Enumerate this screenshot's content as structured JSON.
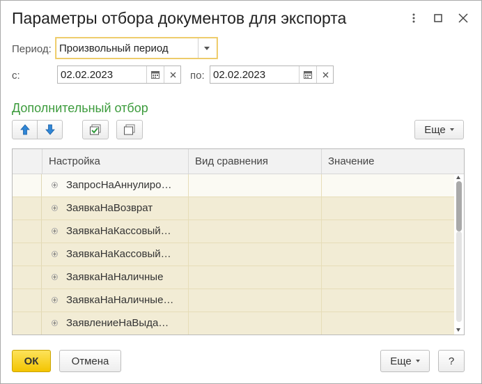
{
  "window": {
    "title": "Параметры отбора документов для экспорта"
  },
  "period": {
    "label": "Период:",
    "value": "Произвольный период"
  },
  "range": {
    "from_label": "с:",
    "from_value": "02.02.2023",
    "to_label": "по:",
    "to_value": "02.02.2023"
  },
  "filter": {
    "section_title": "Дополнительный отбор",
    "more_label": "Еще",
    "columns": [
      "Настройка",
      "Вид сравнения",
      "Значение"
    ],
    "rows": [
      "ЗапросНаАннулиро…",
      "ЗаявкаНаВозврат",
      "ЗаявкаНаКассовый…",
      "ЗаявкаНаКассовый…",
      "ЗаявкаНаНаличные",
      "ЗаявкаНаНаличные…",
      "ЗаявлениеНаВыда…"
    ]
  },
  "footer": {
    "ok_label": "ОК",
    "cancel_label": "Отмена",
    "more_label": "Еще",
    "help_label": "?"
  },
  "colors": {
    "accent_green": "#3c9b3c",
    "ok_yellow": "#f3c400",
    "row_bg": "#f2ecd5",
    "arrow_blue": "#2f86d6"
  }
}
